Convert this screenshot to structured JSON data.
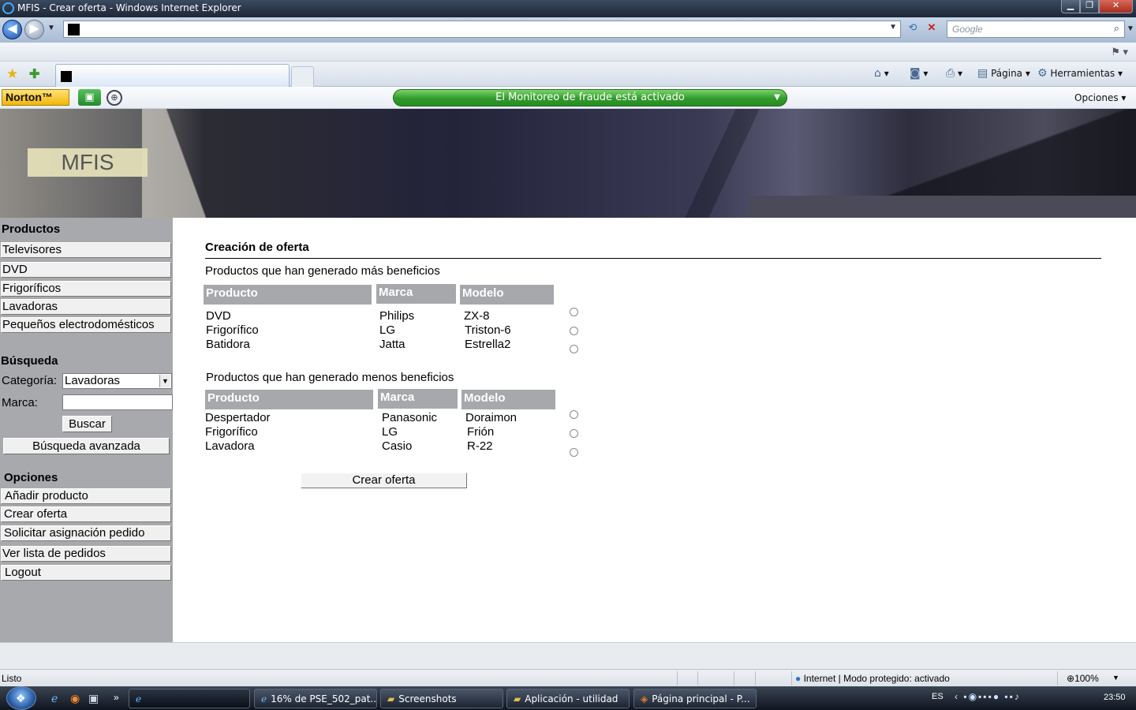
{
  "window": {
    "title": "MFIS - Crear oferta",
    "app_name": "- Windows Internet Explorer",
    "min": "▁",
    "max": "❐",
    "close": "✕"
  },
  "browser": {
    "back_icon": "◀",
    "forward_icon": "▶",
    "search_placeholder": "Google",
    "search_icon": "⌕",
    "refresh_icon": "⟲",
    "stop_icon": "✕",
    "page_menu": "Página",
    "tools_menu": "Herramientas",
    "home_icon": "⌂",
    "feeds_icon": "◙",
    "print_icon": "⎙",
    "page_icon": "▤",
    "tools_icon": "⚙",
    "favorites_icon": "★",
    "add_favorite_icon": "✚"
  },
  "norton": {
    "logo": "Norton™",
    "pc_icon": "▣",
    "web_icon": "⊕",
    "fraud_status": "El Monitoreo de fraude está activado",
    "options": "Opciones"
  },
  "site": {
    "logo_text": "MFIS"
  },
  "sidebar": {
    "products_heading": "Productos",
    "product_items": [
      "Televisores",
      "DVD",
      "Frigoríficos",
      "Lavadoras",
      "Pequeños electrodomésticos"
    ],
    "search_heading": "Búsqueda",
    "category_label": "Categoría:",
    "category_value": "Lavadoras",
    "brand_label": "Marca:",
    "brand_value": "",
    "search_button": "Buscar",
    "advanced_button": "Búsqueda avanzada",
    "options_heading": "Opciones",
    "option_items": [
      "Añadir producto",
      "Crear oferta",
      "Solicitar asignación pedido",
      "Ver lista de pedidos",
      "Logout"
    ]
  },
  "main": {
    "title": "Creación de oferta",
    "top_section_label": "Productos que han generado más beneficios",
    "bottom_section_label": "Productos que han generado menos beneficios",
    "columns": [
      "Producto",
      "Marca",
      "Modelo"
    ],
    "top_rows": [
      [
        "DVD",
        "Philips",
        "ZX-8"
      ],
      [
        "Frigorífico",
        "LG",
        "Triston-6"
      ],
      [
        "Batidora",
        "Jatta",
        "Estrella2"
      ]
    ],
    "bottom_rows": [
      [
        "Despertador",
        "Panasonic",
        "Doraimon"
      ],
      [
        "Frigorífico",
        "LG",
        "Frión"
      ],
      [
        "Lavadora",
        "Casio",
        "R-22"
      ]
    ],
    "create_button": "Crear oferta"
  },
  "status": {
    "text": "Listo",
    "zone": "Internet | Modo protegido: activado",
    "zoom": "100%"
  },
  "taskbar": {
    "tasks": [
      "16% de PSE_502_pat...",
      "Screenshots",
      "Aplicación - utilidad",
      "Página principal - P..."
    ],
    "language": "ES",
    "clock": "23:50",
    "more": "»"
  }
}
